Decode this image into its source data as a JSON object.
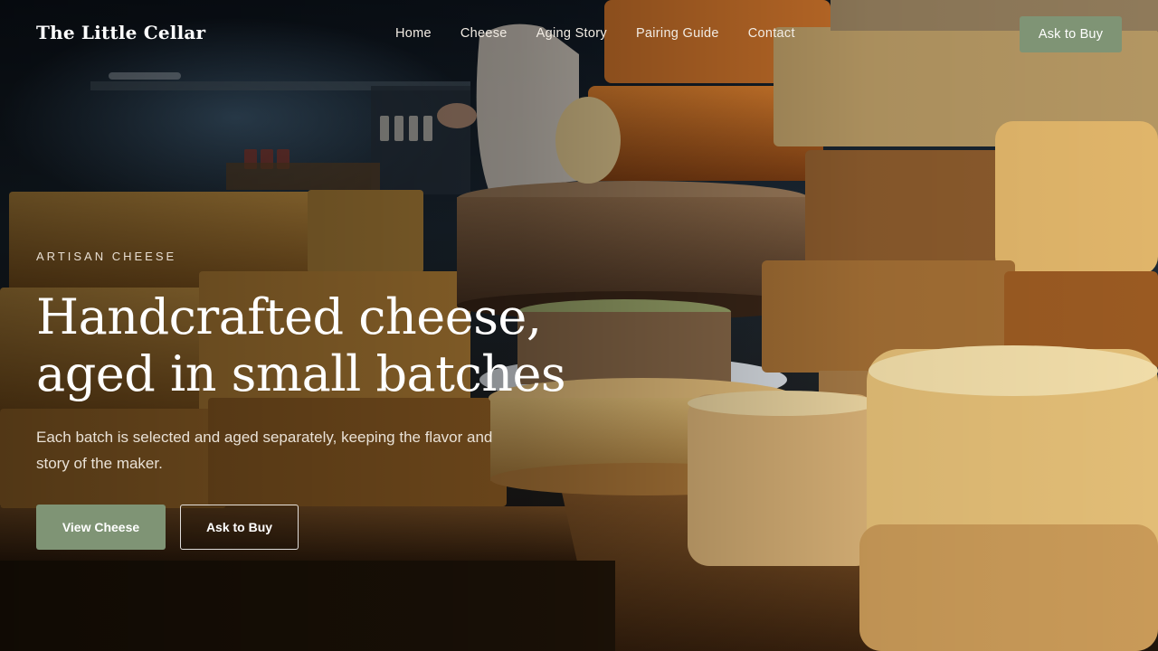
{
  "brand": {
    "name": "The Little Cellar"
  },
  "nav": {
    "links": [
      "Home",
      "Cheese",
      "Aging Story",
      "Pairing Guide",
      "Contact"
    ],
    "cta": "Ask to Buy"
  },
  "hero": {
    "eyebrow": "ARTISAN CHEESE",
    "headline_line1": "Handcrafted cheese,",
    "headline_line2": "aged in small batches",
    "subtext": "Each batch is selected and aged separately, keeping the flavor and story of the maker.",
    "primary_button": "View Cheese",
    "secondary_button": "Ask to Buy",
    "background_image": "cheese-cellar-photo"
  },
  "colors": {
    "accent": "#7f9475",
    "text": "#ffffff"
  }
}
